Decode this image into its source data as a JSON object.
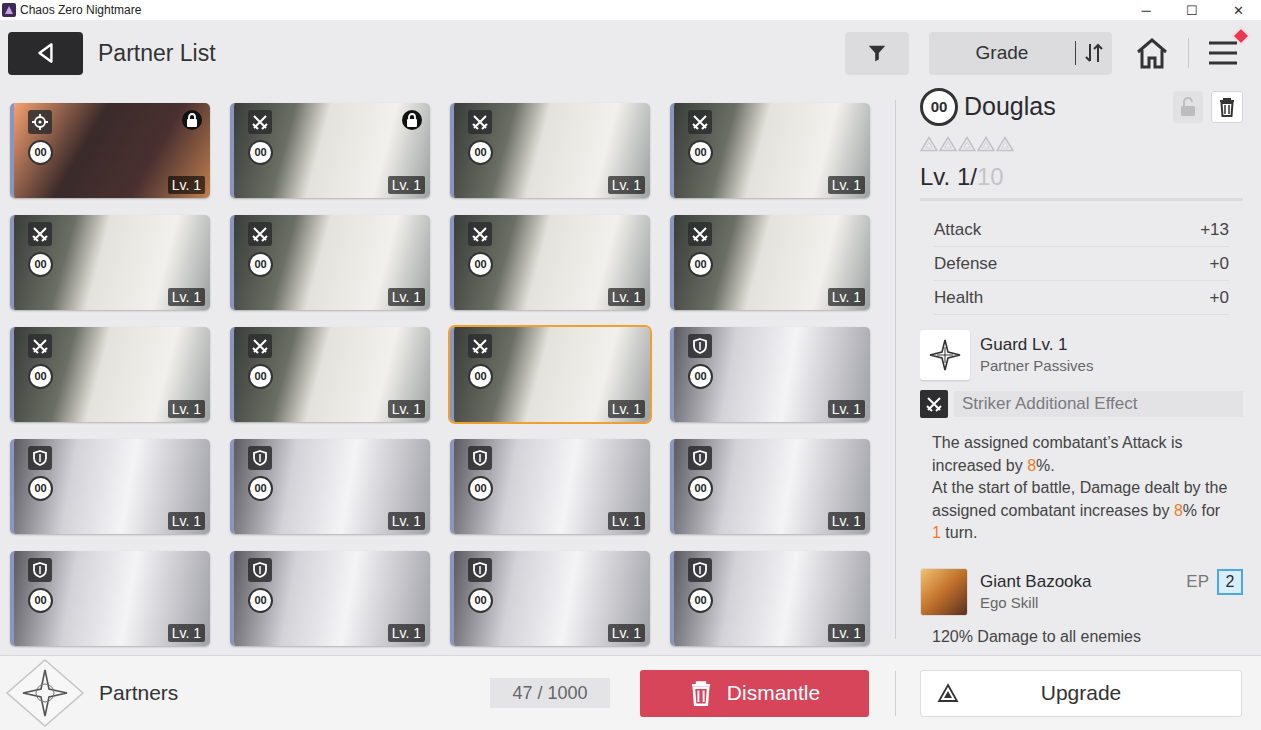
{
  "window": {
    "title": "Chaos Zero Nightmare",
    "controls": [
      "─",
      "☐",
      "✕"
    ]
  },
  "header": {
    "title": "Partner List",
    "sort": {
      "label": "Grade"
    },
    "menu_alert": true
  },
  "partners": [
    {
      "kind": "rabbit",
      "role": "target",
      "badge": "00",
      "level": "Lv. 1",
      "locked": true,
      "selected": false
    },
    {
      "kind": "douglas",
      "role": "striker",
      "badge": "00",
      "level": "Lv. 1",
      "locked": true,
      "selected": false
    },
    {
      "kind": "douglas",
      "role": "striker",
      "badge": "00",
      "level": "Lv. 1",
      "locked": false,
      "selected": false
    },
    {
      "kind": "douglas",
      "role": "striker",
      "badge": "00",
      "level": "Lv. 1",
      "locked": false,
      "selected": false
    },
    {
      "kind": "douglas",
      "role": "striker",
      "badge": "00",
      "level": "Lv. 1",
      "locked": false,
      "selected": false
    },
    {
      "kind": "douglas",
      "role": "striker",
      "badge": "00",
      "level": "Lv. 1",
      "locked": false,
      "selected": false
    },
    {
      "kind": "douglas",
      "role": "striker",
      "badge": "00",
      "level": "Lv. 1",
      "locked": false,
      "selected": false
    },
    {
      "kind": "douglas",
      "role": "striker",
      "badge": "00",
      "level": "Lv. 1",
      "locked": false,
      "selected": false
    },
    {
      "kind": "douglas",
      "role": "striker",
      "badge": "00",
      "level": "Lv. 1",
      "locked": false,
      "selected": false
    },
    {
      "kind": "douglas",
      "role": "striker",
      "badge": "00",
      "level": "Lv. 1",
      "locked": false,
      "selected": false
    },
    {
      "kind": "douglas",
      "role": "striker",
      "badge": "00",
      "level": "Lv. 1",
      "locked": false,
      "selected": true
    },
    {
      "kind": "silver",
      "role": "shield",
      "badge": "00",
      "level": "Lv. 1",
      "locked": false,
      "selected": false
    },
    {
      "kind": "silver",
      "role": "shield",
      "badge": "00",
      "level": "Lv. 1",
      "locked": false,
      "selected": false
    },
    {
      "kind": "silver",
      "role": "shield",
      "badge": "00",
      "level": "Lv. 1",
      "locked": false,
      "selected": false
    },
    {
      "kind": "silver",
      "role": "shield",
      "badge": "00",
      "level": "Lv. 1",
      "locked": false,
      "selected": false
    },
    {
      "kind": "silver",
      "role": "shield",
      "badge": "00",
      "level": "Lv. 1",
      "locked": false,
      "selected": false
    },
    {
      "kind": "silver",
      "role": "shield",
      "badge": "00",
      "level": "Lv. 1",
      "locked": false,
      "selected": false
    },
    {
      "kind": "silver",
      "role": "shield",
      "badge": "00",
      "level": "Lv. 1",
      "locked": false,
      "selected": false
    },
    {
      "kind": "silver",
      "role": "shield",
      "badge": "00",
      "level": "Lv. 1",
      "locked": false,
      "selected": false
    },
    {
      "kind": "silver",
      "role": "shield",
      "badge": "00",
      "level": "Lv. 1",
      "locked": false,
      "selected": false
    }
  ],
  "detail": {
    "badge": "00",
    "name": "Douglas",
    "locked": false,
    "stars": 0,
    "star_slots": 5,
    "level": "Lv. 1/",
    "level_max": "10",
    "stats": [
      {
        "label": "Attack",
        "value": "+13"
      },
      {
        "label": "Defense",
        "value": "+0"
      },
      {
        "label": "Health",
        "value": "+0"
      }
    ],
    "passive": {
      "name": "Guard Lv. 1",
      "type": "Partner Passives"
    },
    "effect": {
      "label": "Striker Additional Effect"
    },
    "description": [
      [
        {
          "text": "The assigned combatant’s Attack is increased by ",
          "highlight": false
        },
        {
          "text": "8",
          "highlight": true
        },
        {
          "text": "%.",
          "highlight": false
        }
      ],
      [
        {
          "text": "At the start of battle, Damage dealt by the assigned combatant increases by ",
          "highlight": false
        },
        {
          "text": "8",
          "highlight": true
        },
        {
          "text": "% for ",
          "highlight": false
        },
        {
          "text": "1",
          "highlight": true
        },
        {
          "text": " turn.",
          "highlight": false
        }
      ]
    ],
    "skill": {
      "name": "Giant Bazooka",
      "type": "Ego Skill",
      "cost_label": "EP",
      "cost": "2",
      "description": "120% Damage to all enemies"
    }
  },
  "footer": {
    "title": "Partners",
    "count": "47 / 1000",
    "dismantle": "Dismantle",
    "upgrade": "Upgrade"
  }
}
